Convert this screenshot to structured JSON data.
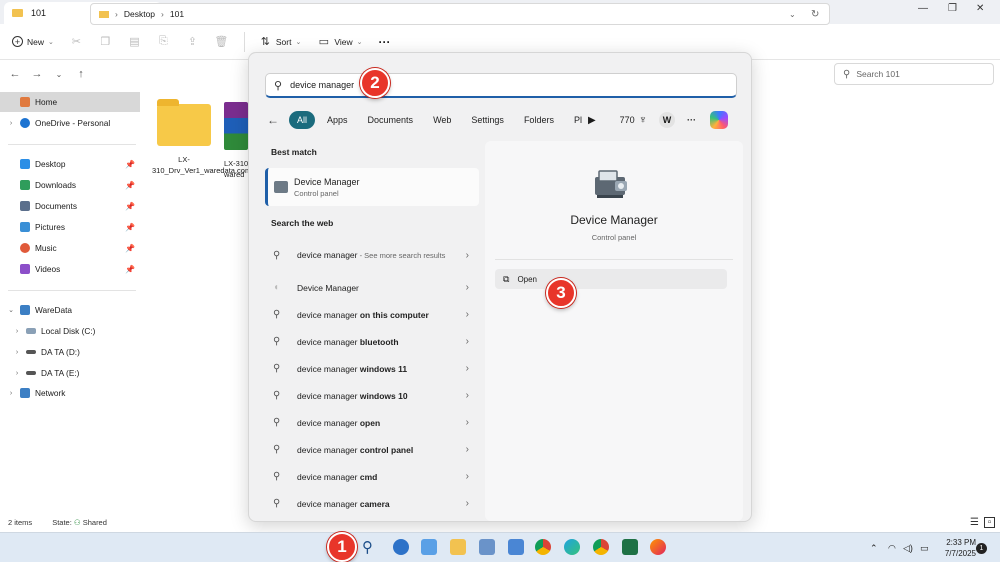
{
  "explorer": {
    "tab_title": "101",
    "toolbar": {
      "new": "New",
      "sort": "Sort",
      "view": "View",
      "more": "···"
    },
    "breadcrumb": [
      "Desktop",
      "101"
    ],
    "search_placeholder": "Search 101",
    "nav": {
      "home": "Home",
      "onedrive": "OneDrive - Personal",
      "desktop": "Desktop",
      "downloads": "Downloads",
      "documents": "Documents",
      "pictures": "Pictures",
      "music": "Music",
      "videos": "Videos",
      "waredata": "WareData",
      "local_c": "Local Disk (C:)",
      "data_d": "DA TA (D:)",
      "data_e": "DA TA (E:)",
      "network": "Network"
    },
    "files": [
      {
        "name": "LX-310_Drv_Ver1_waredata.com"
      },
      {
        "name": "LX-310 wared"
      }
    ],
    "status": {
      "items": "2 items",
      "state_label": "State:",
      "state_value": "Shared"
    }
  },
  "search": {
    "query": "device manager",
    "chips": [
      "All",
      "Apps",
      "Documents",
      "Web",
      "Settings",
      "Folders",
      "Pl"
    ],
    "points": "770",
    "avatar": "W",
    "best_match_label": "Best match",
    "best_match": {
      "name": "Device Manager",
      "type": "Control panel"
    },
    "search_web_label": "Search the web",
    "web_results": [
      {
        "bold": "",
        "plain": "device manager",
        "muted": " - See more search results"
      },
      {
        "bold": "",
        "plain": "Device Manager",
        "muted": ""
      },
      {
        "plain": "device manager ",
        "bold": "on this computer"
      },
      {
        "plain": "device manager ",
        "bold": "bluetooth"
      },
      {
        "plain": "device manager ",
        "bold": "windows 11"
      },
      {
        "plain": "device manager ",
        "bold": "windows 10"
      },
      {
        "plain": "device manager ",
        "bold": "open"
      },
      {
        "plain": "device manager ",
        "bold": "control panel"
      },
      {
        "plain": "device manager ",
        "bold": "cmd"
      },
      {
        "plain": "device manager ",
        "bold": "camera"
      }
    ],
    "detail": {
      "title": "Device Manager",
      "subtitle": "Control panel",
      "open_label": "Open"
    }
  },
  "taskbar": {
    "time": "2:33 PM",
    "date": "7/7/2025",
    "notifications": "1"
  },
  "markers": [
    "1",
    "2",
    "3"
  ],
  "colors": {
    "accent": "#1b6b7d",
    "marker": "#e8352a",
    "focus": "#1f5fa8"
  }
}
